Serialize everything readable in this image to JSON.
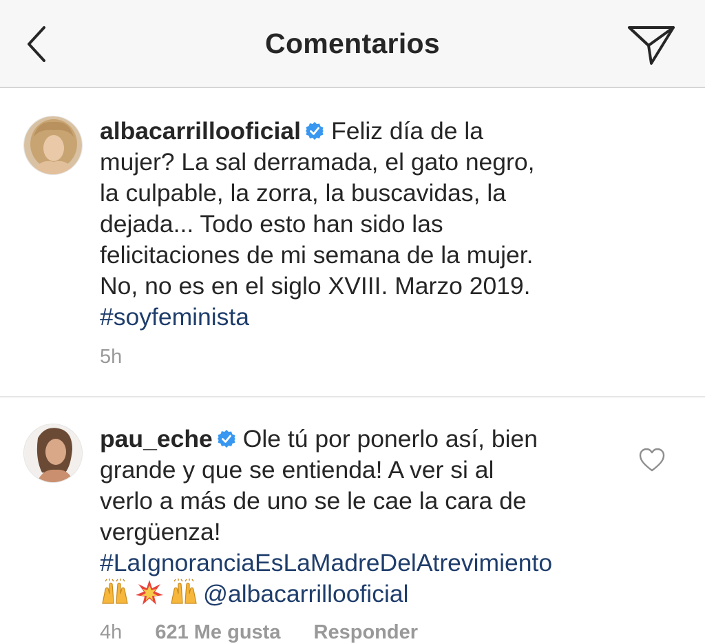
{
  "header": {
    "title": "Comentarios",
    "back_icon": "chevron-left-icon",
    "send_icon": "direct-send-icon"
  },
  "comments": [
    {
      "username": "albacarrillooficial",
      "verified": true,
      "lines": [
        "Feliz día de la",
        "mujer? La sal derramada, el gato negro,",
        "la culpable, la zorra, la buscavidas, la",
        "dejada... Todo esto han sido las",
        "felicitaciones de mi semana de la mujer.",
        "No, no es en el siglo XVIII. Marzo 2019."
      ],
      "hashtag": "#soyfeminista",
      "time": "5h"
    },
    {
      "username": "pau_eche",
      "verified": true,
      "lines": [
        "Ole tú por ponerlo así, bien",
        "grande y que se entienda! A ver si al",
        "verlo a más de uno se le cae la cara de",
        "vergüenza!"
      ],
      "hashtag": "#LaIgnoranciaEsLaMadreDelAtrevimiento",
      "emojis": [
        "raising-hands-emoji",
        "collision-emoji",
        "raising-hands-emoji"
      ],
      "mention": "@albacarrillooficial",
      "time": "4h",
      "likes": "621 Me gusta",
      "reply_label": "Responder",
      "like_icon": "heart-outline-icon"
    }
  ],
  "colors": {
    "link": "#1e3d6b",
    "verified": "#3897f0",
    "meta_text": "#999999",
    "header_bg": "#f7f7f7"
  }
}
